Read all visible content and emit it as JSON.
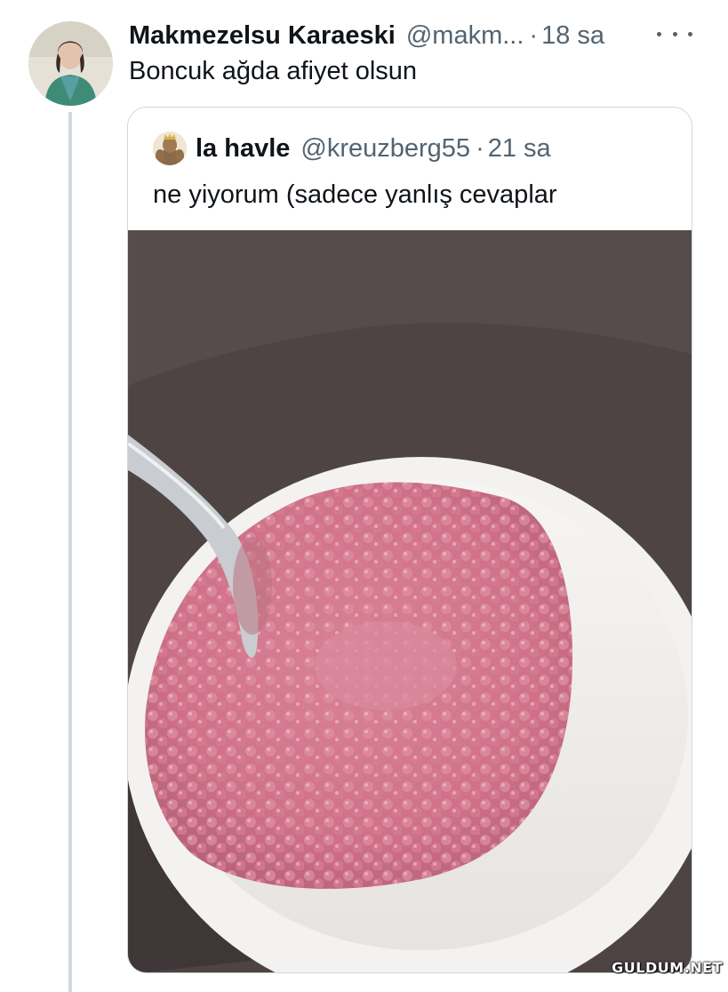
{
  "tweet": {
    "display_name": "Makmezelsu Karaeski",
    "handle": "@makm...",
    "separator": "·",
    "time": "18 sa",
    "text": "Boncuk ağda afiyet olsun",
    "avatar_icon": "user-avatar"
  },
  "quoted_tweet": {
    "display_name": "la havle",
    "handle": "@kreuzberg55",
    "separator": "·",
    "time": "21 sa",
    "text": "ne yiyorum (sadece yanlış cevaplar",
    "media": "photo-pink-pearls-in-white-bowl-with-spoon"
  },
  "watermark": "GULDUM.NET",
  "colors": {
    "text_primary": "#0f1419",
    "text_secondary": "#536471",
    "border": "#cfd9de",
    "background": "#ffffff",
    "food_pink": "#d9788e"
  }
}
